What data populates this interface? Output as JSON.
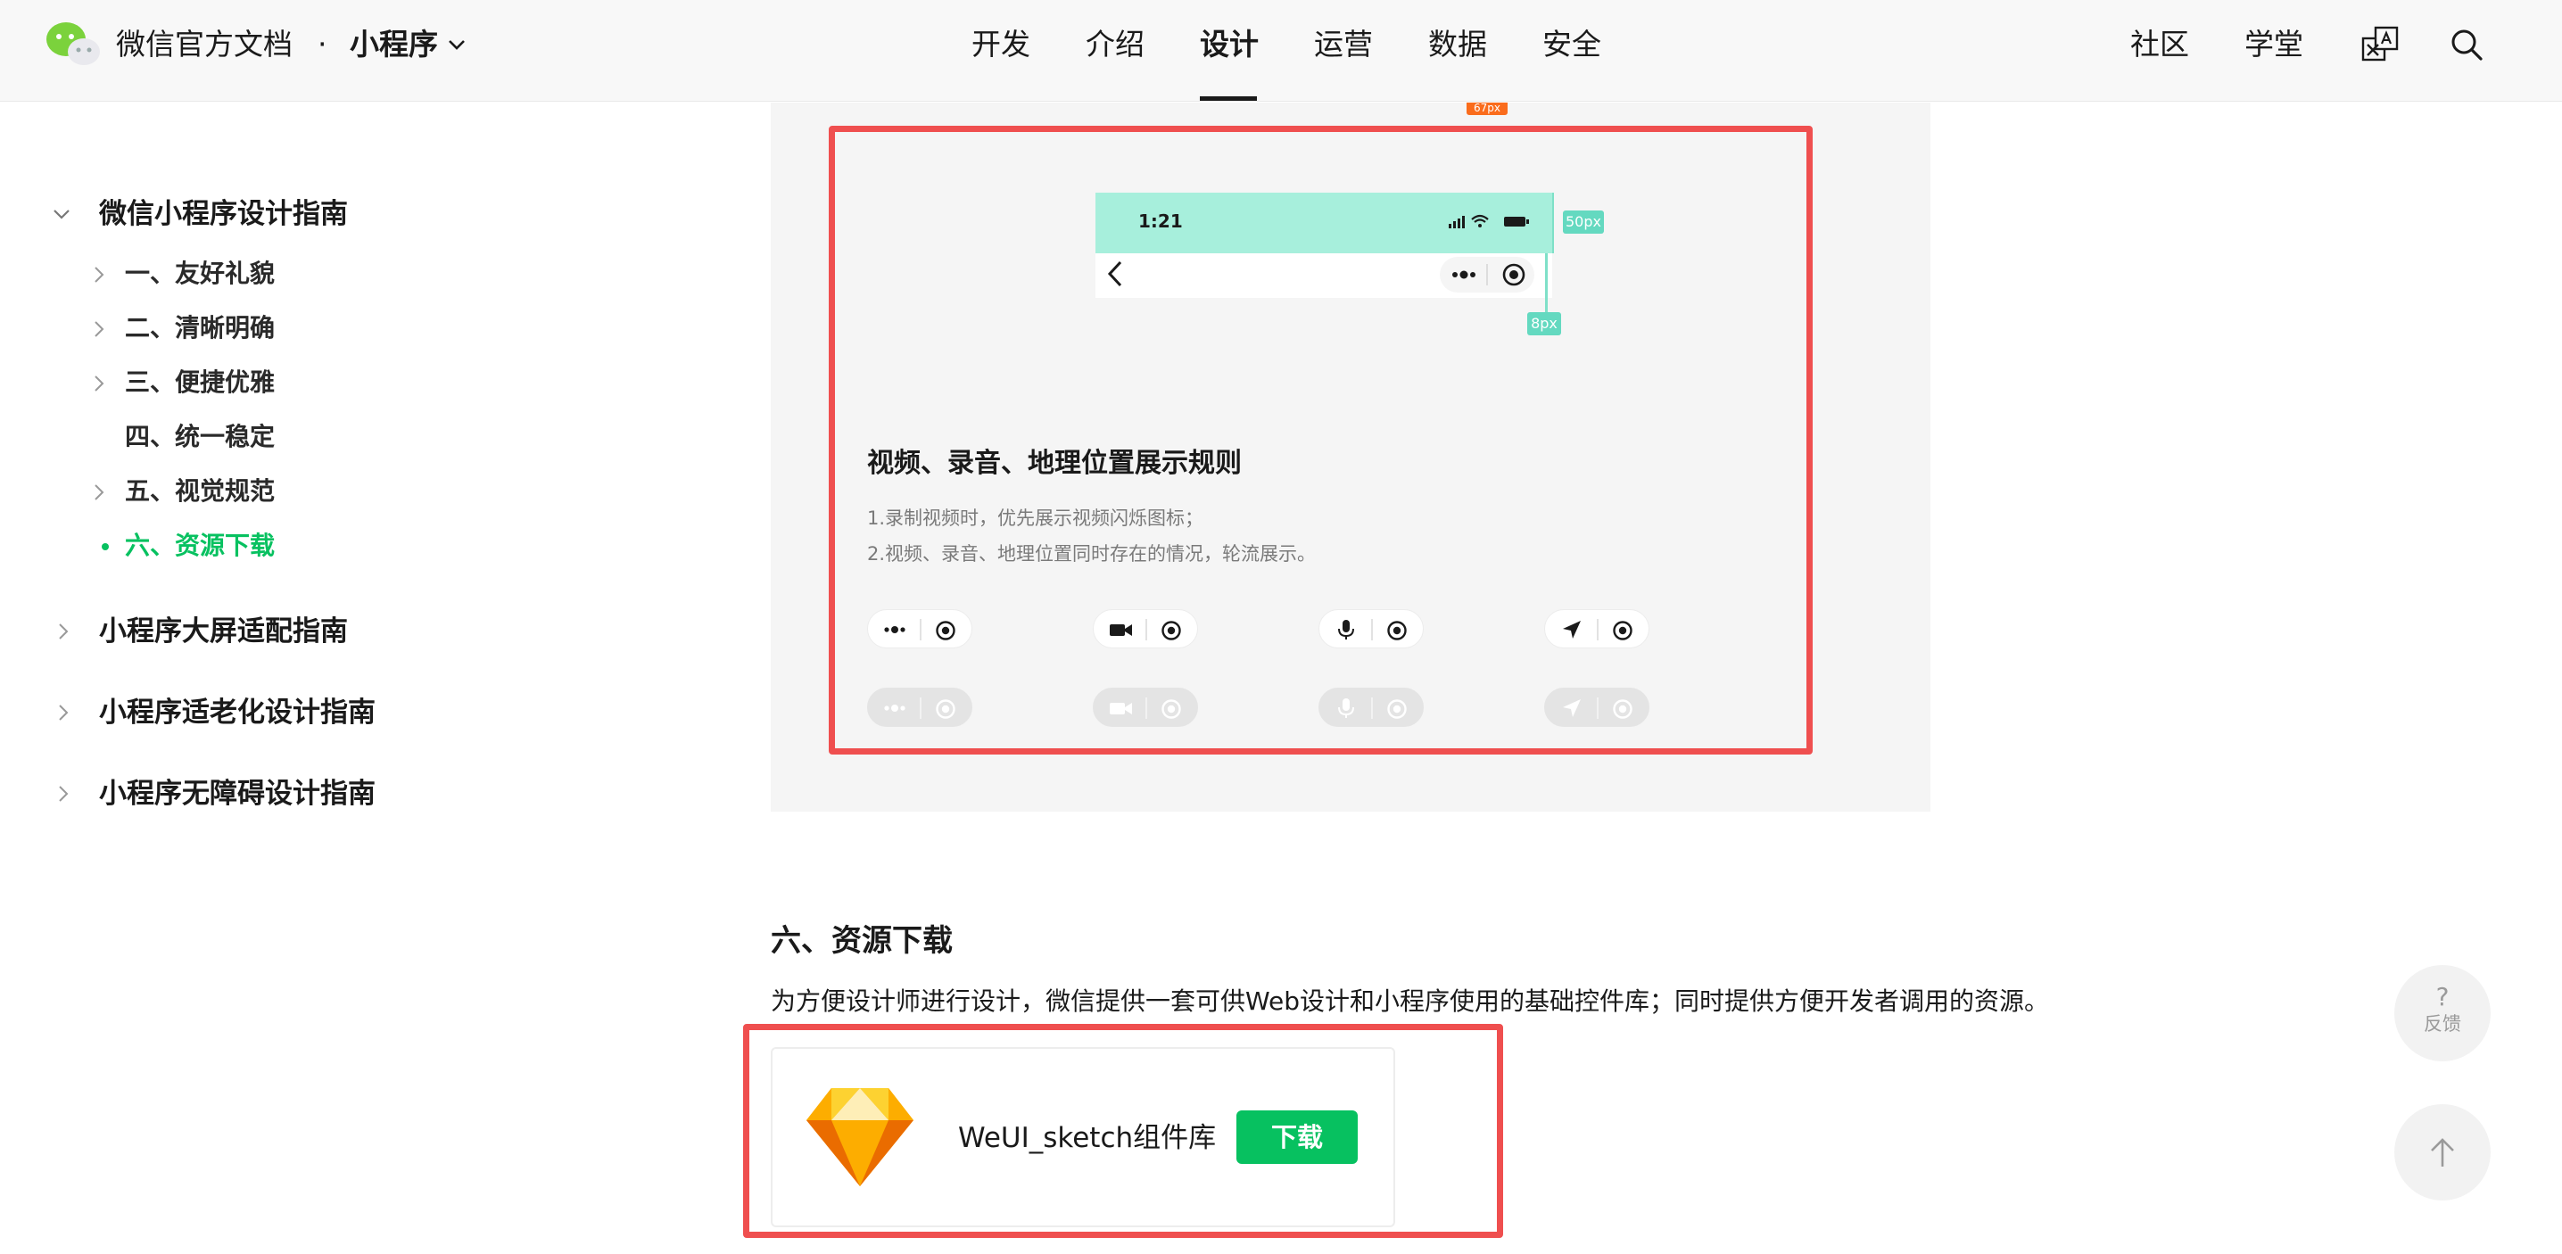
{
  "header": {
    "brand": "微信官方文档",
    "separator": "·",
    "product": "小程序",
    "nav": [
      {
        "label": "开发",
        "active": false
      },
      {
        "label": "介绍",
        "active": false
      },
      {
        "label": "设计",
        "active": true
      },
      {
        "label": "运营",
        "active": false
      },
      {
        "label": "数据",
        "active": false
      },
      {
        "label": "安全",
        "active": false
      }
    ],
    "right": [
      {
        "label": "社区"
      },
      {
        "label": "学堂"
      }
    ],
    "icons": [
      "translate-icon",
      "search-icon"
    ]
  },
  "sidebar": {
    "sections": [
      {
        "label": "微信小程序设计指南",
        "expanded": true,
        "children": [
          {
            "label": "一、友好礼貌",
            "has_children": true
          },
          {
            "label": "二、清晰明确",
            "has_children": true
          },
          {
            "label": "三、便捷优雅",
            "has_children": true
          },
          {
            "label": "四、统一稳定",
            "has_children": false
          },
          {
            "label": "五、视觉规范",
            "has_children": true
          },
          {
            "label": "六、资源下载",
            "has_children": false,
            "active": true
          }
        ]
      },
      {
        "label": "小程序大屏适配指南",
        "expanded": false
      },
      {
        "label": "小程序适老化设计指南",
        "expanded": false
      },
      {
        "label": "小程序无障碍设计指南",
        "expanded": false
      }
    ]
  },
  "figure": {
    "top_tag": "67px",
    "mock_time": "1:21",
    "measure_status": "50px",
    "measure_gap": "8px",
    "title": "视频、录音、地理位置展示规则",
    "rules": [
      "1.录制视频时，优先展示视频闪烁图标；",
      "2.视频、录音、地理位置同时存在的情况，轮流展示。"
    ],
    "capsule_icons": [
      "more-dots-icon",
      "video-camera-icon",
      "microphone-icon",
      "location-arrow-icon"
    ],
    "close_icon": "target-circle-icon"
  },
  "resources": {
    "heading": "六、资源下载",
    "description": "为方便设计师进行设计，微信提供一套可供Web设计和小程序使用的基础控件库；同时提供方便开发者调用的资源。",
    "card": {
      "name": "WeUI_sketch组件库",
      "button": "下载",
      "icon": "sketch-diamond-icon"
    }
  },
  "floating": {
    "feedback_symbol": "?",
    "feedback_label": "反馈",
    "top_icon": "arrow-up-icon"
  },
  "colors": {
    "accent_green": "#07c160",
    "highlight_red": "#ef4f4f",
    "measure_teal": "#64d9c0",
    "status_bar_mint": "#a7efdc",
    "tag_orange": "#fa6c1c"
  }
}
